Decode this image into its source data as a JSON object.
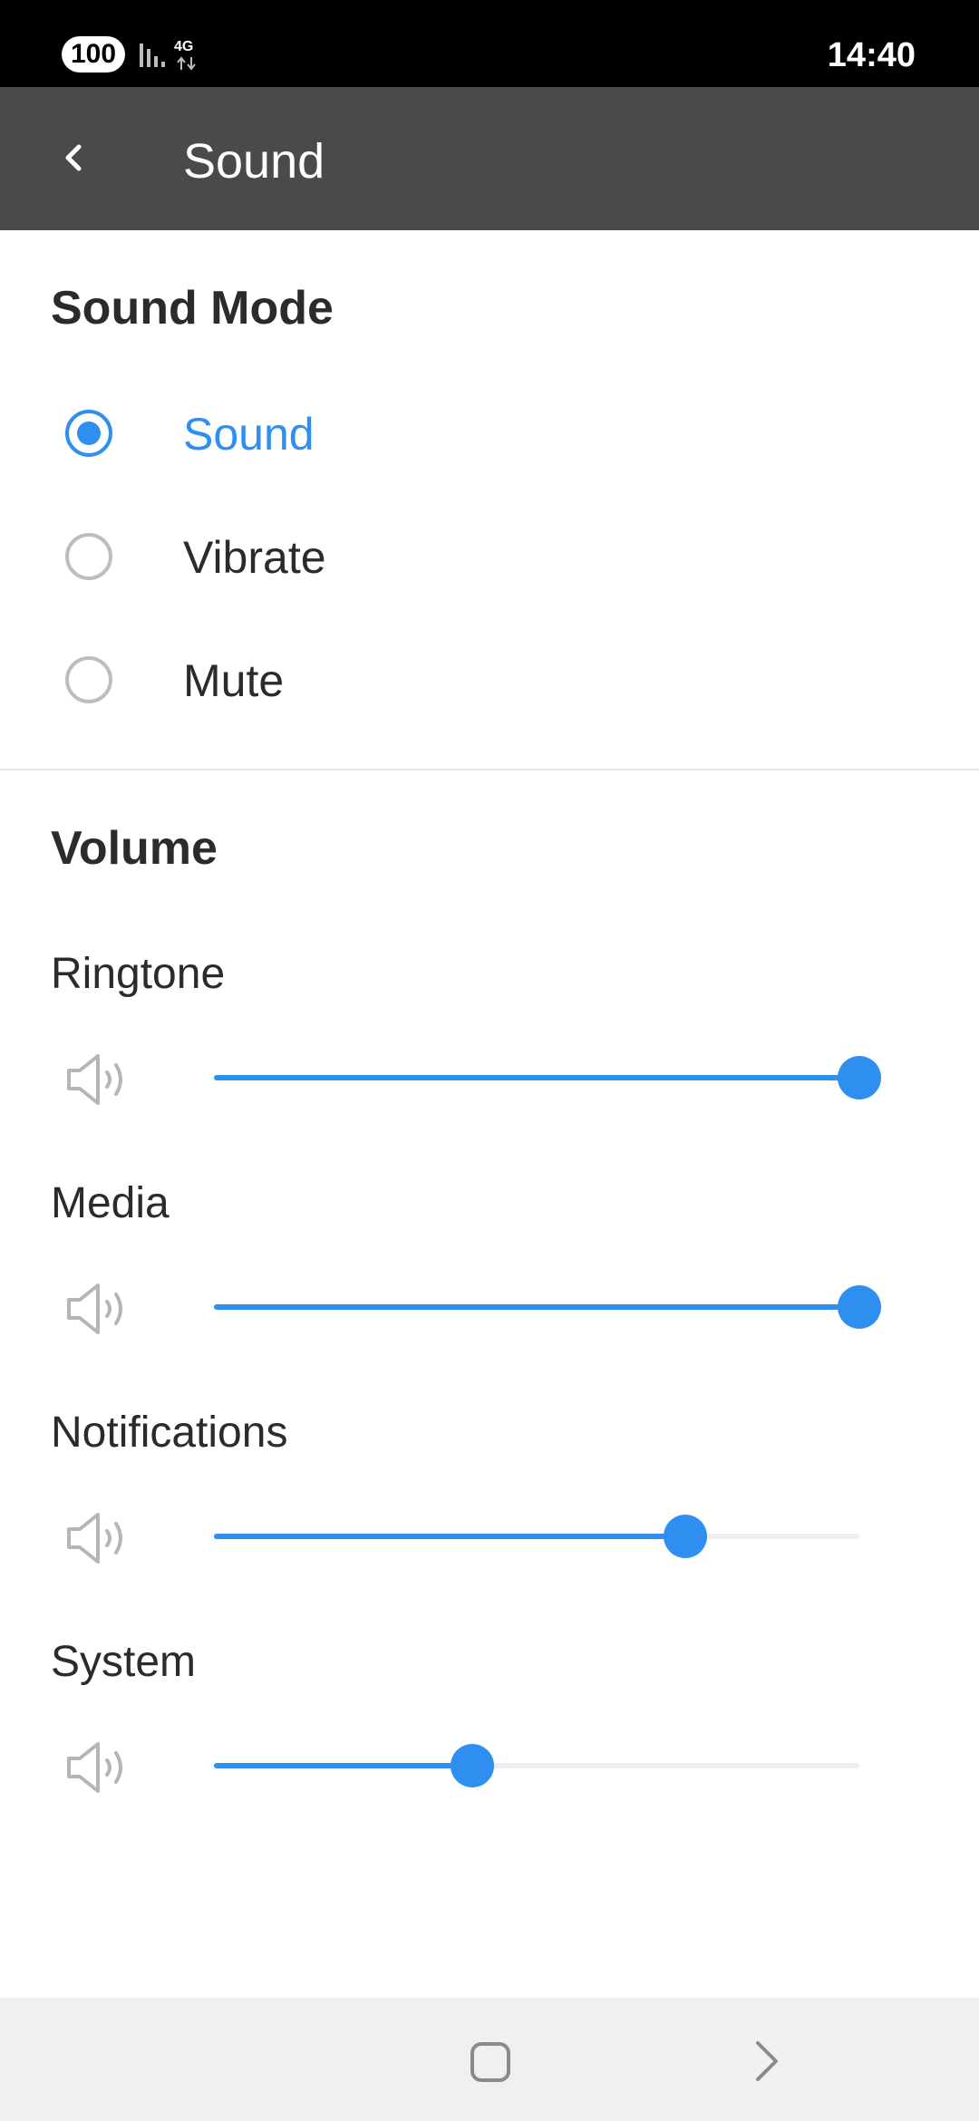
{
  "status_bar": {
    "battery": "100",
    "network": "4G",
    "time": "14:40"
  },
  "header": {
    "title": "Sound",
    "back_icon": "chevron-left-icon"
  },
  "sound_mode": {
    "title": "Sound Mode",
    "options": [
      {
        "label": "Sound",
        "selected": true
      },
      {
        "label": "Vibrate",
        "selected": false
      },
      {
        "label": "Mute",
        "selected": false
      }
    ]
  },
  "volume": {
    "title": "Volume",
    "sliders": [
      {
        "label": "Ringtone",
        "level_percent": 100
      },
      {
        "label": "Media",
        "level_percent": 100
      },
      {
        "label": "Notifications",
        "level_percent": 73
      },
      {
        "label": "System",
        "level_percent": 40
      }
    ]
  },
  "nav_bar": {
    "home_icon": "square-home-icon",
    "forward_icon": "chevron-right-icon"
  },
  "colors": {
    "accent": "#2f8ff0",
    "app_bar": "#4a4a4a",
    "status_bar": "#000000",
    "nav_bar": "#f0f0f2"
  }
}
